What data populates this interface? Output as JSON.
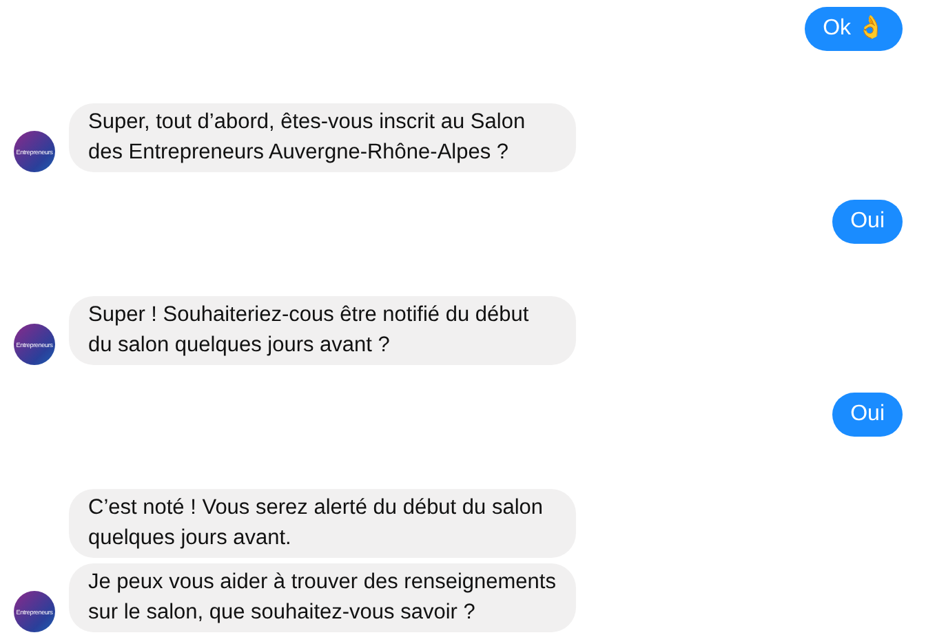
{
  "messages": [
    {
      "kind": "user",
      "bubbles": [
        "Ok 👌"
      ]
    },
    {
      "kind": "bot",
      "avatar_label": "Entrepreneurs",
      "bubbles": [
        "Super, tout d’abord, êtes-vous inscrit au Salon des Entrepreneurs Auvergne-Rhône-Alpes ?"
      ]
    },
    {
      "kind": "user",
      "bubbles": [
        "Oui"
      ]
    },
    {
      "kind": "bot",
      "avatar_label": "Entrepreneurs",
      "bubbles": [
        "Super ! Souhaiteriez-cous être notifié du début du salon quelques jours avant ?"
      ]
    },
    {
      "kind": "user",
      "bubbles": [
        "Oui"
      ]
    },
    {
      "kind": "bot",
      "avatar_label": "Entrepreneurs",
      "bubbles": [
        "C’est noté ! Vous serez alerté du début du salon quelques jours avant.",
        "Je peux vous aider à trouver des renseignements sur le salon, que souhaitez-vous savoir ?"
      ]
    }
  ]
}
